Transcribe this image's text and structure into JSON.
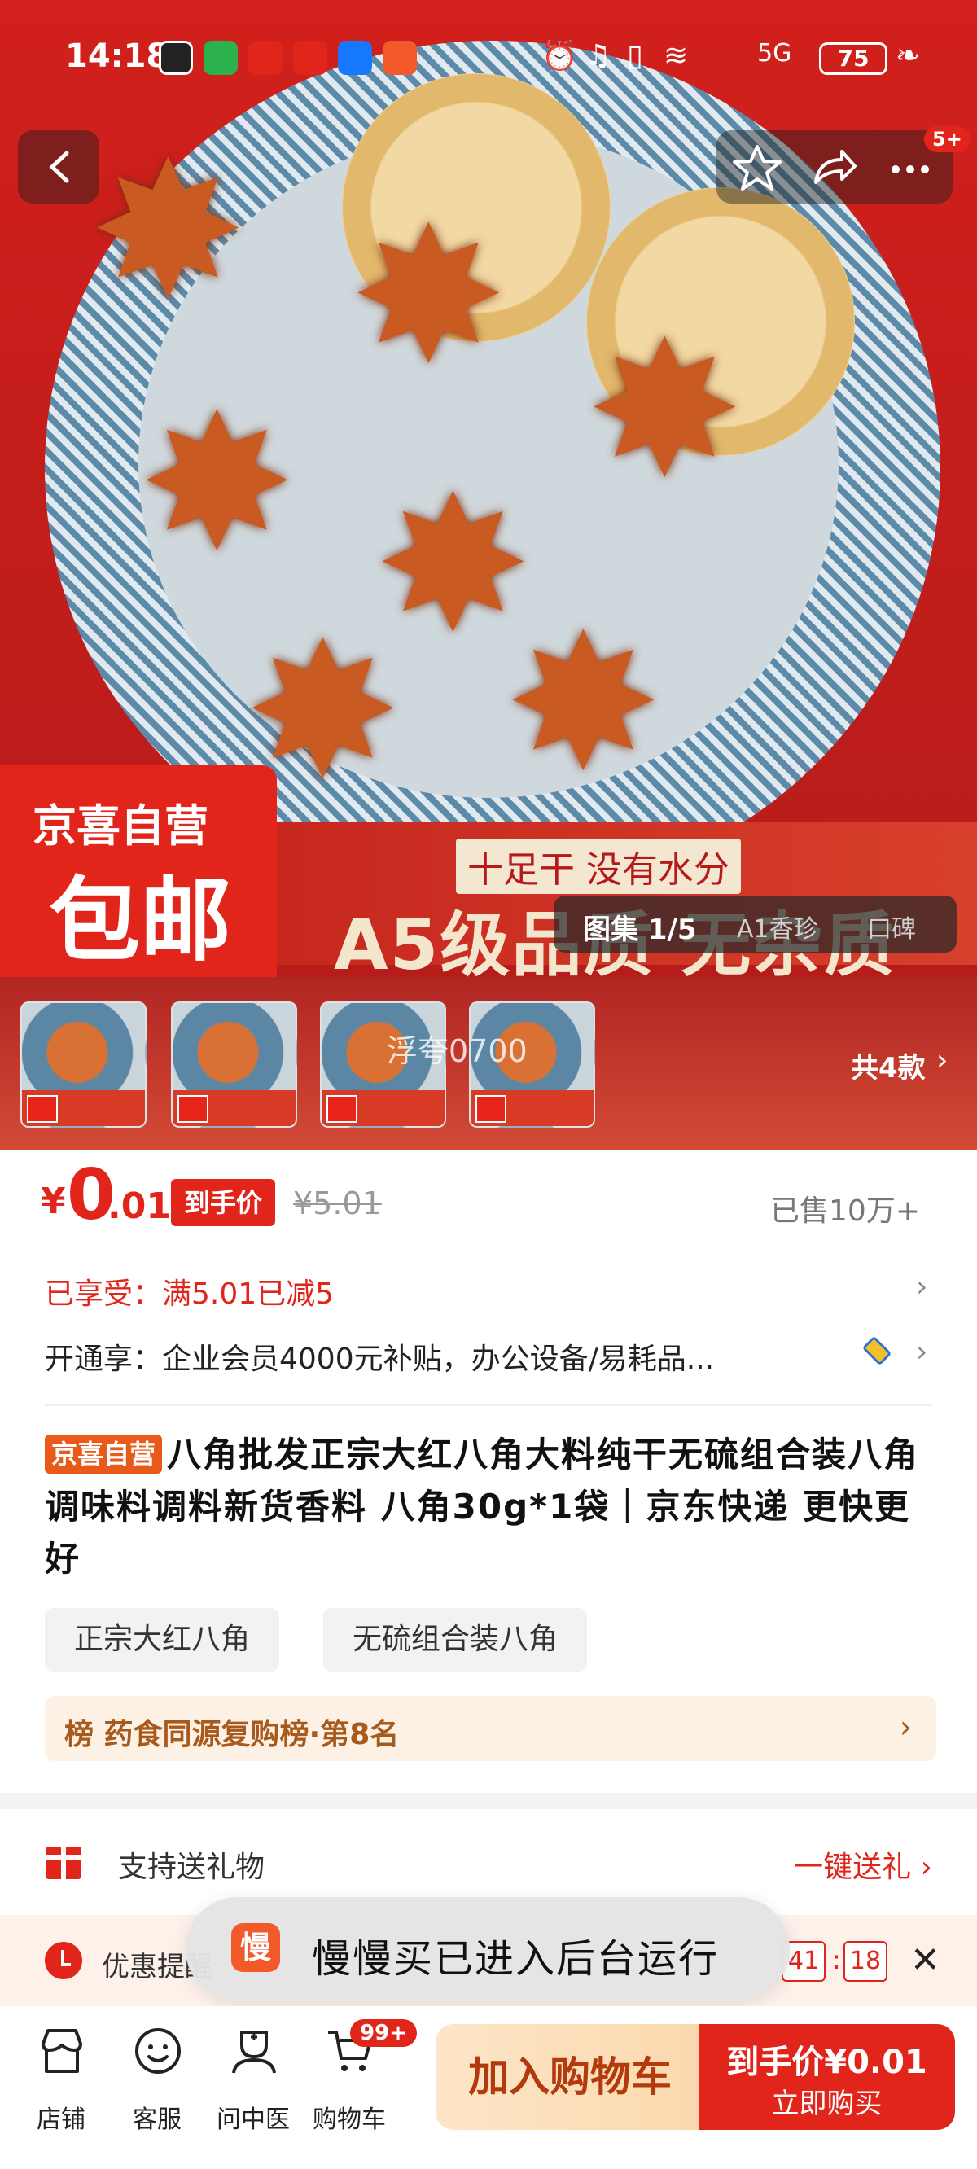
{
  "status_bar": {
    "time": "14:18",
    "network": "5G",
    "battery": "75"
  },
  "hero": {
    "badge_line1": "京喜自营",
    "badge_line2": "包邮",
    "slogan_small": "十足干 没有水分",
    "slogan_big": "A5级品质 无杂质",
    "gallery_label": "图集 1/5",
    "gallery_tab2": "A1香珍",
    "gallery_tab3": "口碑",
    "cart_badge": "5+"
  },
  "thumbnails": {
    "watermark": "浮夸0700",
    "count_label": "共4款"
  },
  "price": {
    "currency": "¥",
    "integer": "0",
    "decimal": ".01",
    "tag": "到手价",
    "original": "¥5.01",
    "sold": "已售10万+"
  },
  "promos": {
    "line1": "已享受：满5.01已减5",
    "line2": "开通享：企业会员4000元补贴，办公设备/易耗品..."
  },
  "product": {
    "badge": "京喜自营",
    "title": "八角批发正宗大红八角大料纯干无硫组合装八角调味料调料新货香料 八角30g*1袋｜京东快递 更快更好",
    "chips": [
      "正宗大红八角",
      "无硫组合装八角"
    ],
    "rank": "榜 药食同源复购榜·第8名"
  },
  "gift": {
    "label": "支持送礼物",
    "action": "一键送礼 ›"
  },
  "reminder": {
    "text": "优惠提醒",
    "minutes": "41",
    "seconds": "18"
  },
  "toast": {
    "icon_char": "慢",
    "text": "慢慢买已进入后台运行"
  },
  "bottom_nav": {
    "items": [
      "店铺",
      "客服",
      "问中医",
      "购物车"
    ],
    "cart_badge": "99+",
    "add_cart": "加入购物车",
    "buy_price": "到手价¥0.01",
    "buy_label": "立即购买"
  },
  "colors": {
    "brand_red": "#e1251b",
    "cart_button": "#fbd8ad"
  }
}
